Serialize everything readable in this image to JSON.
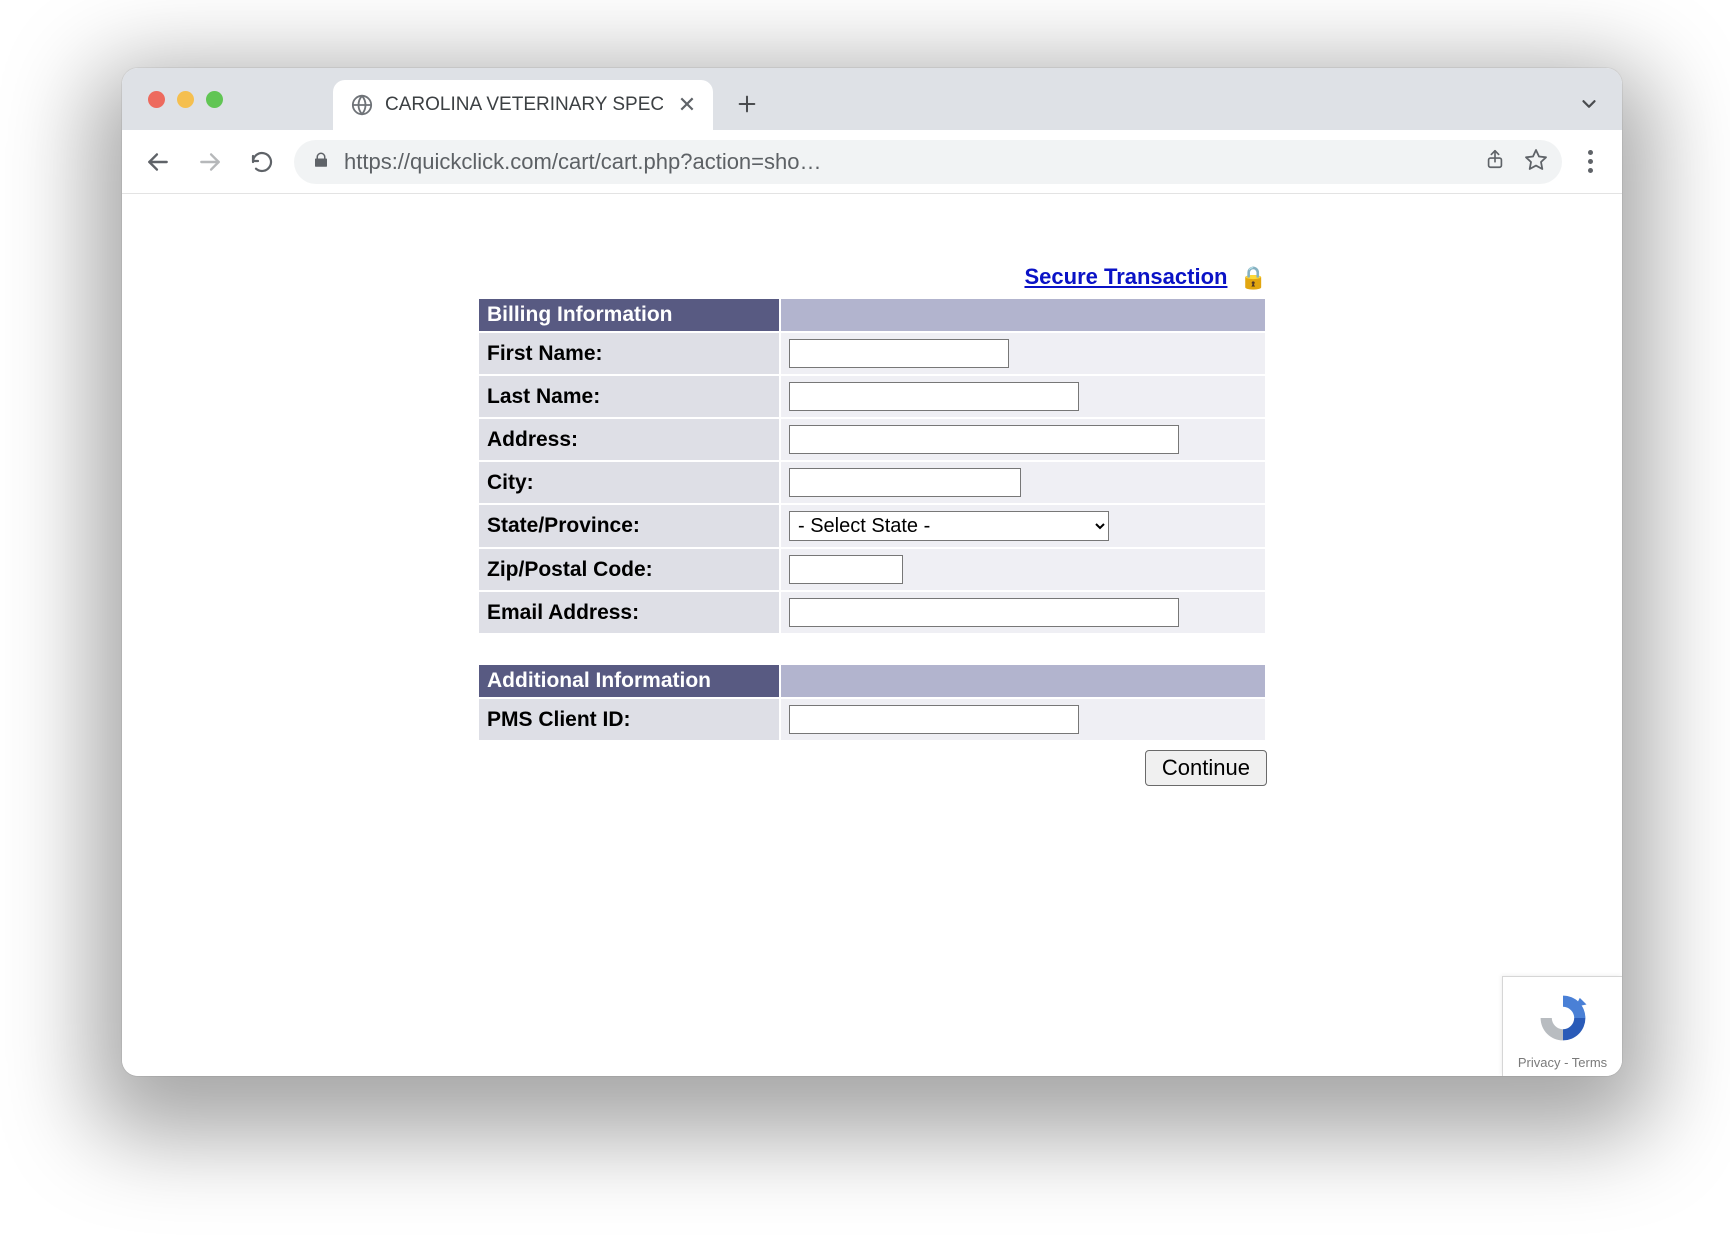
{
  "browser": {
    "tab_title": "CAROLINA VETERINARY SPECI",
    "url": "https://quickclick.com/cart/cart.php?action=sho…"
  },
  "page": {
    "secure_link_text": "Secure Transaction",
    "billing_header": "Billing Information",
    "fields": {
      "first_name_label": "First Name:",
      "first_name_value": "",
      "last_name_label": "Last Name:",
      "last_name_value": "",
      "address_label": "Address:",
      "address_value": "",
      "city_label": "City:",
      "city_value": "",
      "state_label": "State/Province:",
      "state_selected": "- Select State -",
      "zip_label": "Zip/Postal Code:",
      "zip_value": "",
      "email_label": "Email Address:",
      "email_value": ""
    },
    "additional_header": "Additional Information",
    "additional_fields": {
      "pms_label": "PMS Client ID:",
      "pms_value": ""
    },
    "continue_label": "Continue"
  },
  "recaptcha": {
    "privacy": "Privacy",
    "terms": "Terms",
    "sep": " - "
  }
}
